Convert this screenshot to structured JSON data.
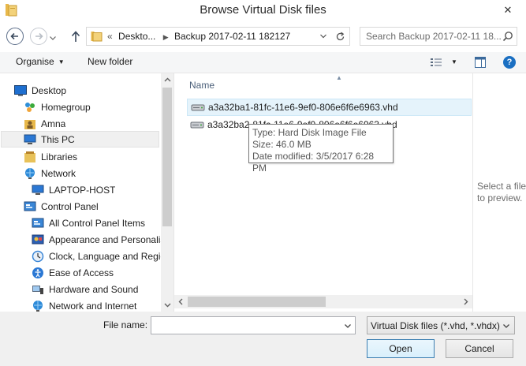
{
  "window": {
    "title": "Browse Virtual Disk files",
    "close_glyph": "✕"
  },
  "address": {
    "prefix": "«",
    "crumbs": [
      "Deskto...",
      "Backup 2017-02-11 182127"
    ],
    "separator": "▶"
  },
  "search": {
    "placeholder": "Search Backup 2017-02-11 18..."
  },
  "toolbar": {
    "organise_label": "Organise",
    "new_folder_label": "New folder",
    "caret": "▼"
  },
  "navigation": {
    "items": [
      {
        "label": "Desktop",
        "icon": "desktop-icon"
      },
      {
        "label": "Homegroup",
        "icon": "homegroup-icon"
      },
      {
        "label": "Amna",
        "icon": "user-folder-icon"
      },
      {
        "label": "This PC",
        "icon": "computer-icon"
      },
      {
        "label": "Libraries",
        "icon": "libraries-icon"
      },
      {
        "label": "Network",
        "icon": "network-icon"
      },
      {
        "label": "LAPTOP-HOST",
        "icon": "computer-icon"
      },
      {
        "label": "Control Panel",
        "icon": "control-panel-icon"
      },
      {
        "label": "All Control Panel Items",
        "icon": "control-panel-icon"
      },
      {
        "label": "Appearance and Personalisation",
        "icon": "appearance-icon"
      },
      {
        "label": "Clock, Language and Region",
        "icon": "clock-icon"
      },
      {
        "label": "Ease of Access",
        "icon": "ease-of-access-icon"
      },
      {
        "label": "Hardware and Sound",
        "icon": "hardware-icon"
      },
      {
        "label": "Network and Internet",
        "icon": "network-icon"
      }
    ]
  },
  "filelist": {
    "column_name": "Name",
    "sort_caret": "▲",
    "files": [
      {
        "name": "a3a32ba1-81fc-11e6-9ef0-806e6f6e6963.vhd",
        "selected": true
      },
      {
        "name": "a3a32ba2-81fc-11e6-9ef0-806e6f6e6963.vhd",
        "selected": false
      }
    ]
  },
  "tooltip": {
    "type": "Type: Hard Disk Image File",
    "size": "Size: 46.0 MB",
    "modified": "Date modified: 3/5/2017 6:28 PM"
  },
  "preview": {
    "message": "Select a file to preview."
  },
  "footer": {
    "filename_label": "File name:",
    "filename_value": "",
    "filter_value": "Virtual Disk files (*.vhd, *.vhdx)",
    "open_label": "Open",
    "cancel_label": "Cancel"
  },
  "colors": {
    "selection_bg": "#e5f3fb",
    "selection_border": "#cde8f7",
    "accent": "#1a6fc2"
  }
}
